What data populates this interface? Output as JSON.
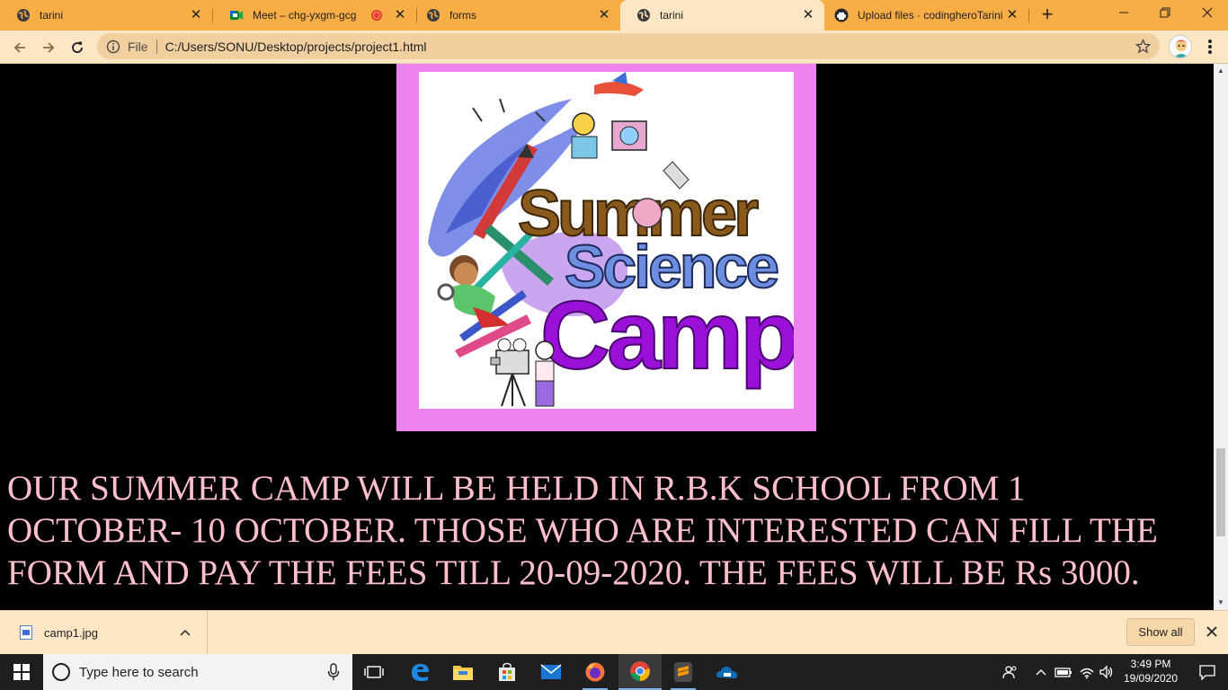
{
  "browser": {
    "tabs": [
      {
        "title": "tarini",
        "icon": "globe-icon",
        "active": false
      },
      {
        "title": "Meet – chg-yxgm-gcg",
        "icon": "google-meet-icon",
        "recording": true,
        "active": false
      },
      {
        "title": "forms",
        "icon": "globe-icon",
        "active": false
      },
      {
        "title": "tarini",
        "icon": "globe-icon",
        "active": true
      },
      {
        "title": "Upload files · codingheroTarini",
        "icon": "github-icon",
        "active": false
      }
    ],
    "close_glyph": "✕",
    "new_tab_glyph": "+",
    "address": {
      "scheme_label": "File",
      "path": "C:/Users/SONU/Desktop/projects/project1.html"
    },
    "colors": {
      "frame": "#f9ad45",
      "toolbar": "#fde6c4",
      "omnibox": "#f1cf9f"
    }
  },
  "page": {
    "background": "#000000",
    "poster": {
      "alt": "camp1.jpg",
      "frame_color": "#ee82ee",
      "lines": [
        "Summer",
        "Science",
        "Camp"
      ]
    },
    "announcement": "OUR SUMMER CAMP WILL BE HELD IN R.B.K SCHOOL FROM 1 OCTOBER- 10 OCTOBER. THOSE WHO ARE INTERESTED CAN FILL THE FORM AND PAY THE FEES TILL 20-09-2020. THE FEES WILL BE Rs 3000.",
    "announcement_color": "#ffc0cb"
  },
  "downloads": {
    "file_name": "camp1.jpg",
    "show_all_label": "Show all"
  },
  "taskbar": {
    "search_placeholder": "Type here to search",
    "apps": [
      "task-view-icon",
      "edge-icon",
      "file-explorer-icon",
      "store-icon",
      "mail-icon",
      "firefox-icon",
      "chrome-icon",
      "sublime-text-icon",
      "onedrive-icon"
    ],
    "clock_time": "3:49 PM",
    "clock_date": "19/09/2020"
  }
}
